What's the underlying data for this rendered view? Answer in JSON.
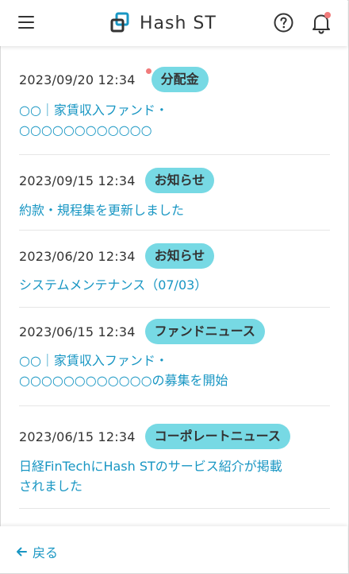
{
  "header": {
    "logo_text": "Hash ST",
    "notification_has_unread": true
  },
  "news": [
    {
      "date": "2023/09/20  12:34",
      "category": "分配金",
      "unread": true,
      "title_lines": [
        "○○｜家賃収入ファンド・",
        "○○○○○○○○○○○○"
      ]
    },
    {
      "date": "2023/09/15  12:34",
      "category": "お知らせ",
      "unread": false,
      "title_lines": [
        "約款・規程集を更新しました"
      ]
    },
    {
      "date": "2023/06/20  12:34",
      "category": "お知らせ",
      "unread": false,
      "title_lines": [
        "システムメンテナンス（07/03）"
      ]
    },
    {
      "date": "2023/06/15  12:34",
      "category": "ファンドニュース",
      "unread": false,
      "title_lines": [
        "○○｜家賃収入ファンド・",
        "○○○○○○○○○○○○の募集を開始"
      ]
    },
    {
      "date": "2023/06/15  12:34",
      "category": "コーポレートニュース",
      "unread": false,
      "title_lines": [
        "日経FinTechにHash STのサービス紹介が掲載",
        "されました"
      ]
    }
  ],
  "footer": {
    "back_label": "戻る"
  },
  "colors": {
    "accent_link": "#1896c3",
    "badge_bg": "#77d9e4",
    "unread_dot": "#f17b7b"
  }
}
